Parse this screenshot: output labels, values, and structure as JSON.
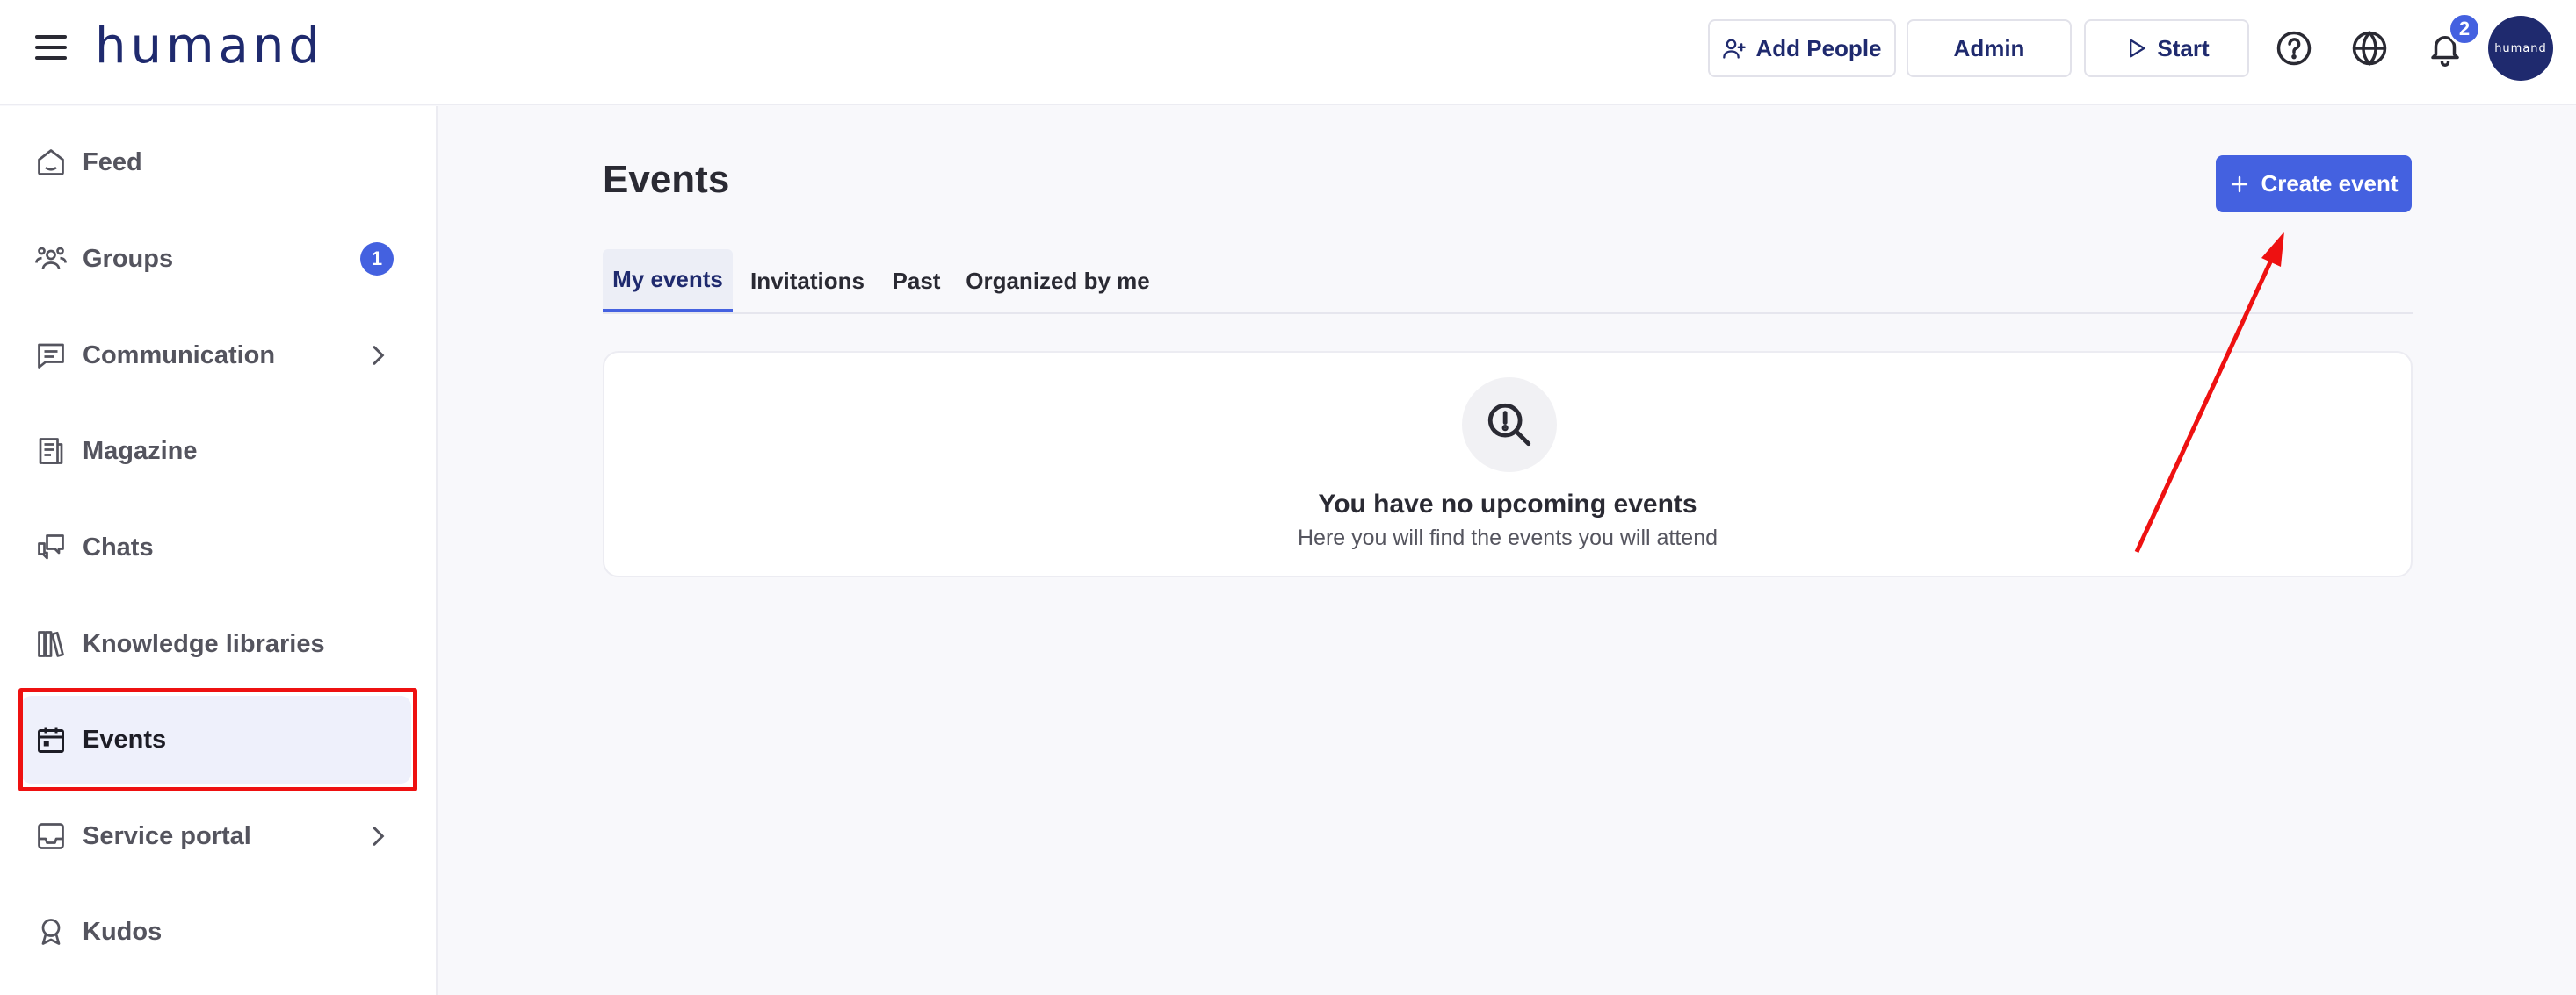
{
  "header": {
    "logo": "humand",
    "add_people_label": "Add People",
    "admin_label": "Admin",
    "start_label": "Start",
    "notification_count": "2",
    "avatar_text": "humand"
  },
  "sidebar": {
    "items": [
      {
        "label": "Feed",
        "icon": "home-icon"
      },
      {
        "label": "Groups",
        "icon": "groups-icon",
        "badge": "1"
      },
      {
        "label": "Communication",
        "icon": "message-icon",
        "chevron": true
      },
      {
        "label": "Magazine",
        "icon": "magazine-icon"
      },
      {
        "label": "Chats",
        "icon": "chats-icon"
      },
      {
        "label": "Knowledge libraries",
        "icon": "library-icon"
      },
      {
        "label": "Events",
        "icon": "calendar-icon",
        "active": true
      },
      {
        "label": "Service portal",
        "icon": "inbox-icon",
        "chevron": true
      },
      {
        "label": "Kudos",
        "icon": "award-icon"
      }
    ]
  },
  "main": {
    "title": "Events",
    "create_label": "Create event",
    "tabs": [
      {
        "label": "My events",
        "active": true
      },
      {
        "label": "Invitations"
      },
      {
        "label": "Past"
      },
      {
        "label": "Organized by me"
      }
    ],
    "empty": {
      "title": "You have no upcoming events",
      "subtitle": "Here you will find the events you will attend"
    }
  },
  "colors": {
    "accent": "#4461e0",
    "brand": "#1f2a6e",
    "annotation": "#ee1111"
  }
}
